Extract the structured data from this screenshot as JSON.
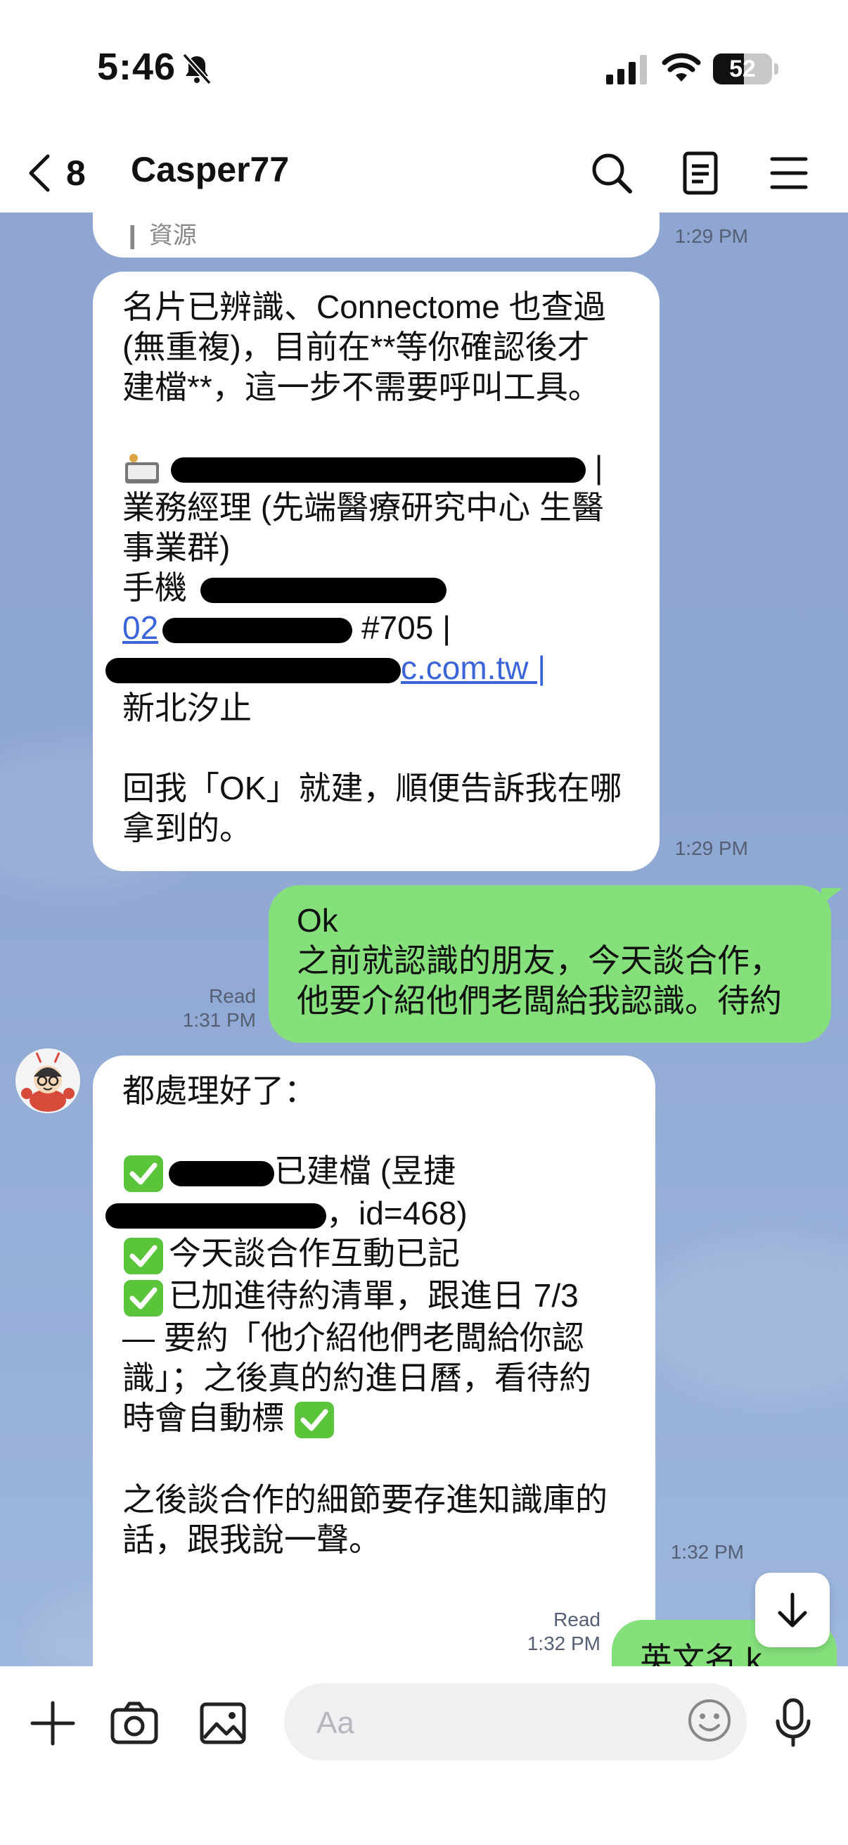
{
  "status_bar": {
    "time": "5:46",
    "battery": "52",
    "battery_level": 0.52
  },
  "header": {
    "back_count": "8",
    "title": "Casper77"
  },
  "messages": {
    "m0": {
      "partial_text": "資源",
      "time": "1:29 PM"
    },
    "m1": {
      "lines": [
        "名片已辨識、Connectome 也查過",
        "(無重複)，目前在**等你確認後才",
        "建檔**，這一步不需要呼叫工具。",
        "",
        "|",
        "業務經理 (先端醫療研究中心 生醫",
        "事業群)",
        "手機",
        "#705 |",
        "c.com.tw |",
        "新北汐止",
        "",
        "回我「OK」就建，順便告訴我在哪",
        "拿到的。"
      ],
      "phone_prefix": "02",
      "time": "1:29 PM"
    },
    "m2": {
      "lines": [
        "Ok",
        "之前就認識的朋友，今天談合作，",
        "他要介紹他們老闆給我認識。待約"
      ],
      "status": "Read",
      "time": "1:31 PM"
    },
    "m3": {
      "lines": [
        "都處理好了：",
        "",
        "已建檔 (昱捷",
        "，id=468)",
        "今天談合作互動已記",
        "已加進待約清單，跟進日 7/3",
        "— 要約「他介紹他們老闆給你認",
        "識」；之後真的約進日曆，看待約",
        "時會自動標",
        "",
        "之後談合作的細節要存進知識庫的",
        "話，跟我說一聲。"
      ],
      "time": "1:32 PM"
    },
    "m4": {
      "text": "英文名 k",
      "status": "Read",
      "time": "1:32 PM"
    }
  },
  "input": {
    "placeholder": "Aa"
  },
  "icons": {
    "back": "chevron-left-icon",
    "search": "search-icon",
    "notes": "notes-icon",
    "menu": "menu-icon",
    "plus": "plus-icon",
    "camera": "camera-icon",
    "image": "image-icon",
    "emoji": "emoji-icon",
    "mic": "mic-icon",
    "scroll": "arrow-down-icon",
    "check": "check-mark-emoji"
  },
  "colors": {
    "chat_background": "#8fa6d2",
    "incoming_bubble": "#ffffff",
    "outgoing_bubble": "#85e07c",
    "link": "#3a64d8",
    "check_green": "#5ac43a"
  }
}
